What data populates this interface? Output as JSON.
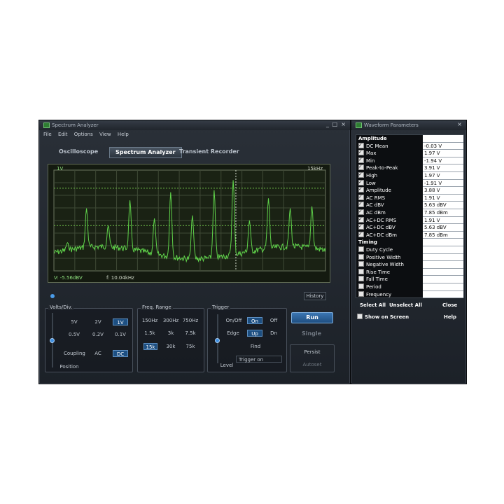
{
  "main_window": {
    "title": "Spectrum Analyzer",
    "win_buttons": [
      "_",
      "□",
      "×"
    ],
    "menu": [
      "File",
      "Edit",
      "Options",
      "View",
      "Help"
    ],
    "tabs": [
      "Oscilloscope",
      "Spectrum Analyzer",
      "Transient Recorder"
    ],
    "active_tab": "Spectrum Analyzer",
    "display": {
      "top_left": "1V",
      "top_right": "15kHz",
      "readout_v": "V: -5.56dBV",
      "readout_f": "f: 10.04kHz",
      "history": "History"
    },
    "volts_div": {
      "title": "Volts/Div.",
      "row1": [
        "5V",
        "2V",
        "1V"
      ],
      "row2": [
        "0.5V",
        "0.2V",
        "0.1V"
      ],
      "selected": "1V",
      "coupling_label": "Coupling",
      "coupling": [
        "AC",
        "DC"
      ],
      "coupling_selected": "DC",
      "position_label": "Position"
    },
    "freq_range": {
      "title": "Freq. Range",
      "row1": [
        "150Hz",
        "300Hz",
        "750Hz"
      ],
      "row2": [
        "1.5k",
        "3k",
        "7.5k"
      ],
      "row3": [
        "15k",
        "30k",
        "75k"
      ],
      "selected": "15k"
    },
    "trigger": {
      "title": "Trigger",
      "onoff_label": "On/Off",
      "onoff": [
        "On",
        "Off"
      ],
      "onoff_selected": "On",
      "edge_label": "Edge",
      "edge": [
        "Up",
        "Dn"
      ],
      "edge_selected": "Up",
      "find": "Find",
      "level_label": "Level",
      "status": "Trigger on"
    },
    "buttons": {
      "run": "Run",
      "single": "Single",
      "persist": "Persist",
      "autoset": "Autoset"
    }
  },
  "params_window": {
    "title": "Waveform Parameters",
    "win_buttons": [
      "×"
    ],
    "amplitude_header": "Amplitude",
    "amplitude": [
      {
        "label": "DC  Mean",
        "value": "-0.03 V",
        "checked": true
      },
      {
        "label": "Max",
        "value": "1.97 V",
        "checked": true
      },
      {
        "label": "Min",
        "value": "-1.94 V",
        "checked": true
      },
      {
        "label": "Peak-to-Peak",
        "value": "3.91 V",
        "checked": true
      },
      {
        "label": "High",
        "value": "1.97 V",
        "checked": true
      },
      {
        "label": "Low",
        "value": "-1.91 V",
        "checked": true
      },
      {
        "label": "Amplitude",
        "value": "3.88 V",
        "checked": true
      },
      {
        "label": "AC RMS",
        "value": "1.91 V",
        "checked": true
      },
      {
        "label": "AC dBV",
        "value": "5.63 dBV",
        "checked": true
      },
      {
        "label": "AC dBm",
        "value": "7.85 dBm",
        "checked": true
      },
      {
        "label": "AC+DC RMS",
        "value": "1.91 V",
        "checked": true
      },
      {
        "label": "AC+DC dBV",
        "value": "5.63 dBV",
        "checked": true
      },
      {
        "label": "AC+DC dBm",
        "value": "7.85 dBm",
        "checked": true
      }
    ],
    "timing_header": "Timing",
    "timing": [
      {
        "label": "Duty Cycle",
        "value": "",
        "checked": false
      },
      {
        "label": "Positive Width",
        "value": "",
        "checked": false
      },
      {
        "label": "Negative Width",
        "value": "",
        "checked": false
      },
      {
        "label": "Rise Time",
        "value": "",
        "checked": false
      },
      {
        "label": "Fall Time",
        "value": "",
        "checked": false
      },
      {
        "label": "Period",
        "value": "",
        "checked": false
      },
      {
        "label": "Frequency",
        "value": "",
        "checked": false
      }
    ],
    "select_all": "Select All",
    "unselect_all": "Unselect All",
    "close": "Close",
    "show_on_screen": "Show on Screen",
    "help": "Help"
  }
}
